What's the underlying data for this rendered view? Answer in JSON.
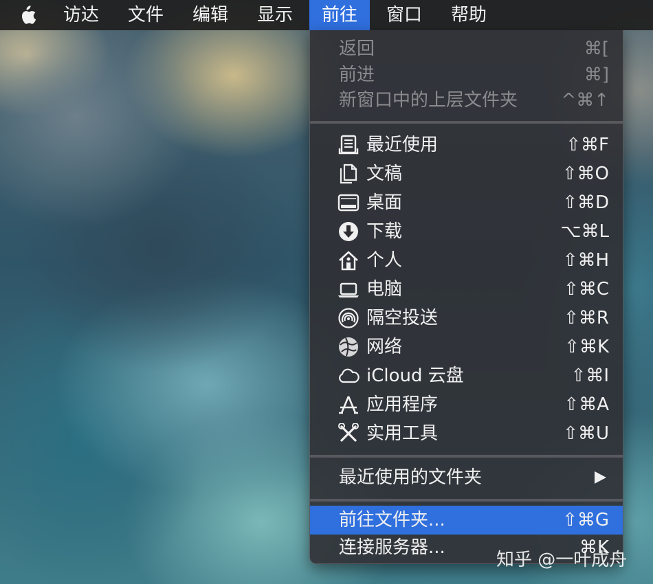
{
  "menubar": {
    "items": [
      "访达",
      "文件",
      "编辑",
      "显示",
      "前往",
      "窗口",
      "帮助"
    ],
    "active": "前往"
  },
  "menu": {
    "disabled_items": [
      {
        "label": "返回",
        "shortcut": "⌘["
      },
      {
        "label": "前进",
        "shortcut": "⌘]"
      },
      {
        "label": "新窗口中的上层文件夹",
        "shortcut": "^⌘↑"
      }
    ],
    "places": [
      {
        "label": "最近使用",
        "shortcut": "⇧⌘F",
        "icon": "recents-icon"
      },
      {
        "label": "文稿",
        "shortcut": "⇧⌘O",
        "icon": "documents-icon"
      },
      {
        "label": "桌面",
        "shortcut": "⇧⌘D",
        "icon": "desktop-icon"
      },
      {
        "label": "下载",
        "shortcut": "⌥⌘L",
        "icon": "downloads-icon"
      },
      {
        "label": "个人",
        "shortcut": "⇧⌘H",
        "icon": "home-icon"
      },
      {
        "label": "电脑",
        "shortcut": "⇧⌘C",
        "icon": "computer-icon"
      },
      {
        "label": "隔空投送",
        "shortcut": "⇧⌘R",
        "icon": "airdrop-icon"
      },
      {
        "label": "网络",
        "shortcut": "⇧⌘K",
        "icon": "network-icon"
      },
      {
        "label": "iCloud 云盘",
        "shortcut": "⇧⌘I",
        "icon": "icloud-icon"
      },
      {
        "label": "应用程序",
        "shortcut": "⇧⌘A",
        "icon": "applications-icon"
      },
      {
        "label": "实用工具",
        "shortcut": "⇧⌘U",
        "icon": "utilities-icon"
      }
    ],
    "recent_folders": {
      "label": "最近使用的文件夹"
    },
    "goto_folder": {
      "label": "前往文件夹...",
      "shortcut": "⇧⌘G"
    },
    "connect_server": {
      "label": "连接服务器...",
      "shortcut": "⌘K"
    }
  },
  "watermark": "知乎 @一叶成舟",
  "colors": {
    "highlight": "#2f6fde",
    "menubar_bg": "#201e1e",
    "disabled_text": "#8b8b8f"
  }
}
